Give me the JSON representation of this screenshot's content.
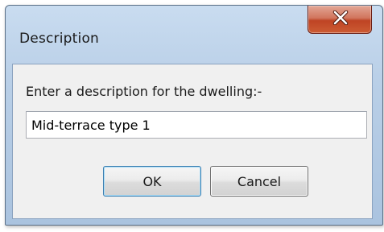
{
  "dialog": {
    "title": "Description",
    "close_glyph": "X",
    "prompt": "Enter a description for the dwelling:-",
    "input_value": "Mid-terrace type 1",
    "ok_label": "OK",
    "cancel_label": "Cancel"
  },
  "icons": {
    "close": "close-icon"
  },
  "colors": {
    "title_bar": "#b9cfe7",
    "close_button": "#c9502f",
    "client_background": "#f0f0f0",
    "default_button_border": "#3c7fb1"
  }
}
